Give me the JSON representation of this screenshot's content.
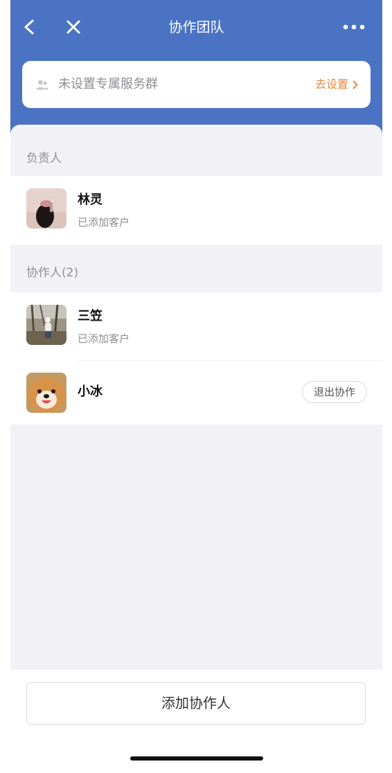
{
  "nav": {
    "title": "协作团队",
    "back_icon": "chevron-left-icon",
    "close_icon": "close-icon",
    "more_icon": "more-dots-icon"
  },
  "service_group": {
    "icon": "group-icon",
    "text": "未设置专属服务群",
    "link": "去设置",
    "link_color": "#e9883a"
  },
  "owner_section": {
    "title": "负责人",
    "member": {
      "name": "林灵",
      "status": "已添加客户"
    }
  },
  "collaborator_section": {
    "title": "协作人(2)",
    "members": [
      {
        "name": "三笠",
        "status": "已添加客户"
      },
      {
        "name": "小冰",
        "action": "退出协作"
      }
    ]
  },
  "add_button": {
    "label": "添加协作人"
  },
  "colors": {
    "header": "#4a73c4",
    "page_bg": "#f2f2f6",
    "accent_orange": "#e9883a"
  }
}
